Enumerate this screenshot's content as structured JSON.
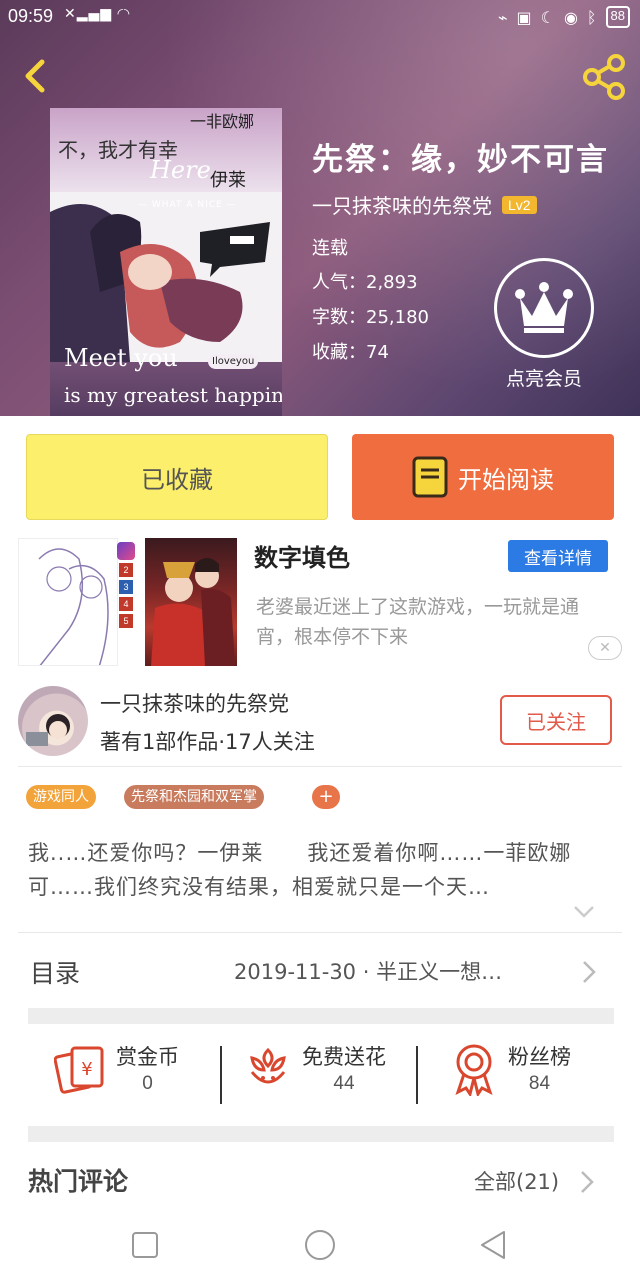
{
  "status_bar": {
    "time": "09:59",
    "battery": "88"
  },
  "book": {
    "title": "先祭：缘，妙不可言",
    "author": "一只抹茶味的先祭党",
    "level": "Lv2",
    "status": "连载",
    "popularity": "人气：2,893",
    "word_count": "字数：25,180",
    "favorites": "收藏：74",
    "vip_label": "点亮会员"
  },
  "cover": {
    "top_text": "不，我才有幸",
    "top_text2": "一非欧娜",
    "here": "Here",
    "yilai": "伊莱",
    "small": "— WHAT A NICE —",
    "love_bubble": "Iloveyou",
    "meet": "Meet you",
    "happiness": "is my greatest happiness"
  },
  "actions": {
    "fav_label": "已收藏",
    "read_label": "开始阅读"
  },
  "ad": {
    "title": "数字填色",
    "detail_label": "查看详情",
    "description": "老婆最近迷上了这款游戏，一玩就是通宵，根本停不下来",
    "close": "✕",
    "strip_numbers": [
      "2",
      "3",
      "4",
      "5"
    ]
  },
  "author_card": {
    "name": "一只抹茶味的先祭党",
    "stats": "著有1部作品·17人关注",
    "follow_label": "已关注"
  },
  "tags": [
    {
      "label": "游戏同人",
      "color": "#f2a33a"
    },
    {
      "label": "先祭和杰园和双军掌",
      "color": "#c97b5e"
    }
  ],
  "tag_add": "+",
  "synopsis": "我..…还爱你吗？一伊莱　　我还爱着你啊……一菲欧娜可……我们终究没有结果，相爱就只是一个天…",
  "toc": {
    "label": "目录",
    "info": "2019-11-30 · 半正义一想…"
  },
  "stats": [
    {
      "label": "赏金币",
      "value": "0",
      "icon": "red-envelope-icon"
    },
    {
      "label": "免费送花",
      "value": "44",
      "icon": "flower-icon"
    },
    {
      "label": "粉丝榜",
      "value": "84",
      "icon": "medal-icon"
    }
  ],
  "comments": {
    "label": "热门评论",
    "all_label": "全部(21)"
  },
  "colors": {
    "accent_orange": "#ef6d3e",
    "fav_yellow": "#fbef6c",
    "follow_red": "#e15a4a",
    "detail_blue": "#2c7be5"
  }
}
